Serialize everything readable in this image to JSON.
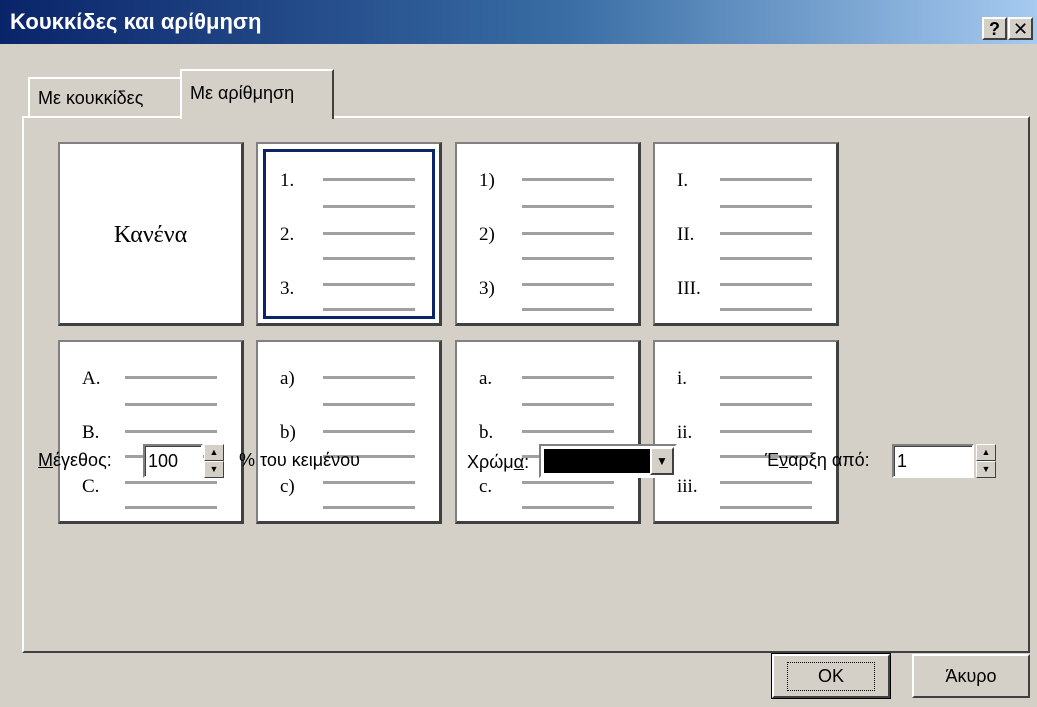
{
  "window": {
    "title": "Κουκκίδες και αρίθμηση",
    "help_glyph": "?",
    "close_glyph": "✕"
  },
  "tabs": [
    {
      "label": "Με κουκκίδες",
      "active": false
    },
    {
      "label": "Με αρίθμηση",
      "active": true
    }
  ],
  "styles": [
    {
      "none_label": "Κανένα"
    },
    {
      "markers": [
        "1.",
        "2.",
        "3."
      ],
      "selected": true
    },
    {
      "markers": [
        "1)",
        "2)",
        "3)"
      ]
    },
    {
      "markers": [
        "I.",
        "II.",
        "III."
      ]
    },
    {
      "markers": [
        "A.",
        "B.",
        "C."
      ]
    },
    {
      "markers": [
        "a)",
        "b)",
        "c)"
      ]
    },
    {
      "markers": [
        "a.",
        "b.",
        "c."
      ]
    },
    {
      "markers": [
        "i.",
        "ii.",
        "iii."
      ]
    }
  ],
  "size": {
    "label_underlined": "Μ",
    "label_rest": "έγεθος:",
    "value": "100",
    "suffix": "% του κειμένου"
  },
  "color": {
    "label_before": "Χρώμ",
    "label_underlined": "α",
    "label_after": ":",
    "value": "#000000"
  },
  "start": {
    "label_before": "Έ",
    "label_underlined": "ν",
    "label_after": "αρξη από:",
    "value": "1"
  },
  "buttons": {
    "ok": "OK",
    "cancel": "Άκυρο"
  },
  "spin_icons": {
    "up": "▲",
    "down": "▼"
  },
  "dropdown_icon": "▼"
}
